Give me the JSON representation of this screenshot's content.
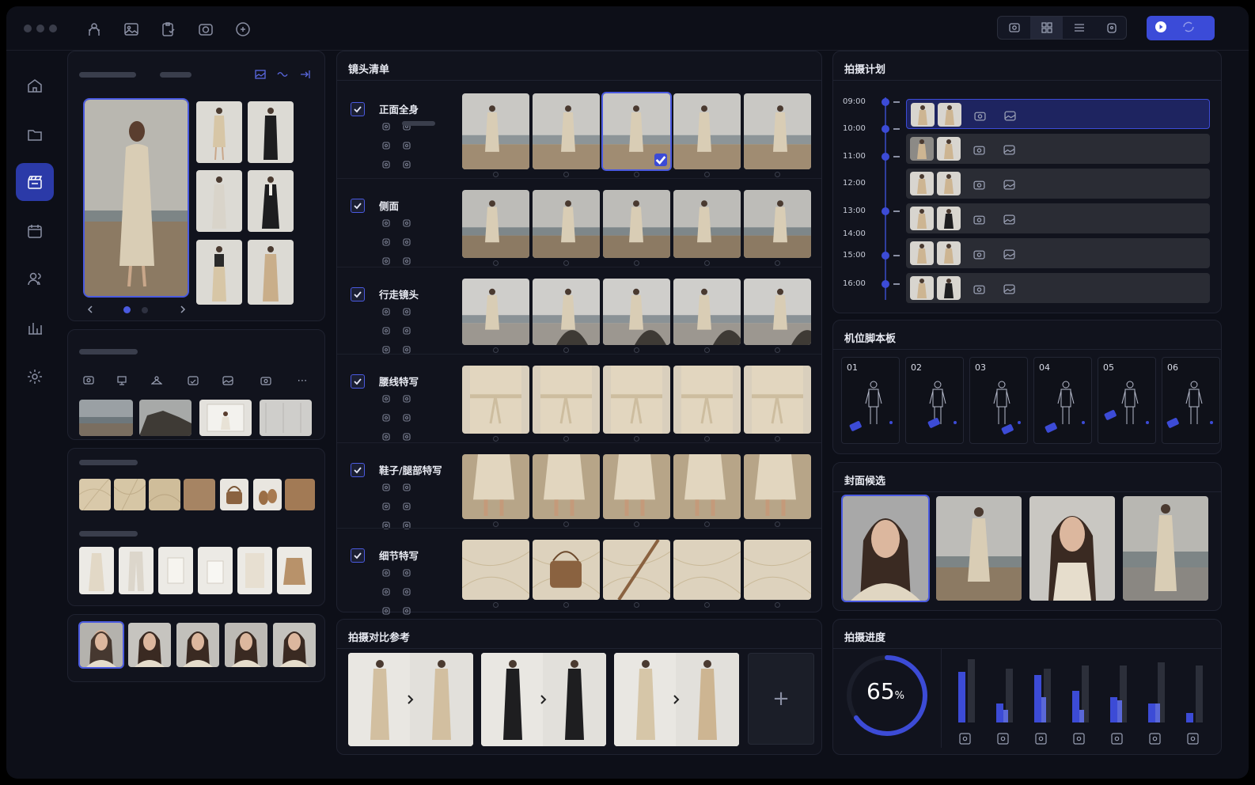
{
  "titlebar": {
    "tool_icons": [
      "model-icon",
      "image-gallery-icon",
      "clipboard-icon",
      "camera-icon",
      "settings-badge-icon"
    ],
    "view_icons": [
      "single-view-icon",
      "grid-view-icon",
      "list-view-icon",
      "lock-view-icon"
    ],
    "run_button": {
      "icon": "play-icon",
      "secondary_icon": "sync-icon"
    }
  },
  "sidebar": {
    "items": [
      "home-icon",
      "folder-icon",
      "clapperboard-icon",
      "calendar-icon",
      "team-icon",
      "chart-icon",
      "settings-icon"
    ],
    "active": 2
  },
  "shot_list": {
    "title": "镜头清单",
    "rows": [
      {
        "label": "正面全身",
        "checked": true
      },
      {
        "label": "侧面",
        "checked": true
      },
      {
        "label": "行走镜头",
        "checked": true
      },
      {
        "label": "腰线特写",
        "checked": true
      },
      {
        "label": "鞋子/腿部特写",
        "checked": true
      },
      {
        "label": "细节特写",
        "checked": true
      }
    ]
  },
  "plan": {
    "title": "拍摄计划",
    "times": [
      "09:00",
      "10:00",
      "11:00",
      "12:00",
      "13:00",
      "14:00",
      "15:00",
      "16:00"
    ]
  },
  "storyboard": {
    "title": "机位脚本板",
    "boards": [
      "01",
      "02",
      "03",
      "04",
      "05",
      "06"
    ]
  },
  "cover": {
    "title": "封面候选"
  },
  "compare": {
    "title": "拍摄对比参考",
    "add_symbol": "+"
  },
  "progress": {
    "title": "拍摄进度",
    "value_text": "65",
    "unit": "%",
    "percent": 65
  },
  "chart_data": {
    "type": "bar",
    "categories": [
      "model",
      "check",
      "team",
      "gallery",
      "camera",
      "cloud",
      "figure"
    ],
    "series": [
      {
        "values": [
          0.8,
          0.3,
          0.75,
          0.5,
          0.4,
          0.3,
          0.15
        ]
      },
      {
        "values": [
          0.0,
          0.2,
          0.4,
          0.2,
          0.35,
          0.3,
          0.0
        ]
      },
      {
        "values": [
          1.0,
          0.85,
          0.85,
          0.9,
          0.9,
          0.95,
          0.9
        ]
      }
    ],
    "icons": [
      "figure-icon",
      "check-square-icon",
      "team-icon",
      "gallery-icon",
      "camera-icon",
      "cloud-icon",
      "person-icon"
    ],
    "colors": {
      "primary": "#3c4bd6",
      "secondary": "#5a68d8",
      "track": "#2c2f3a"
    }
  }
}
